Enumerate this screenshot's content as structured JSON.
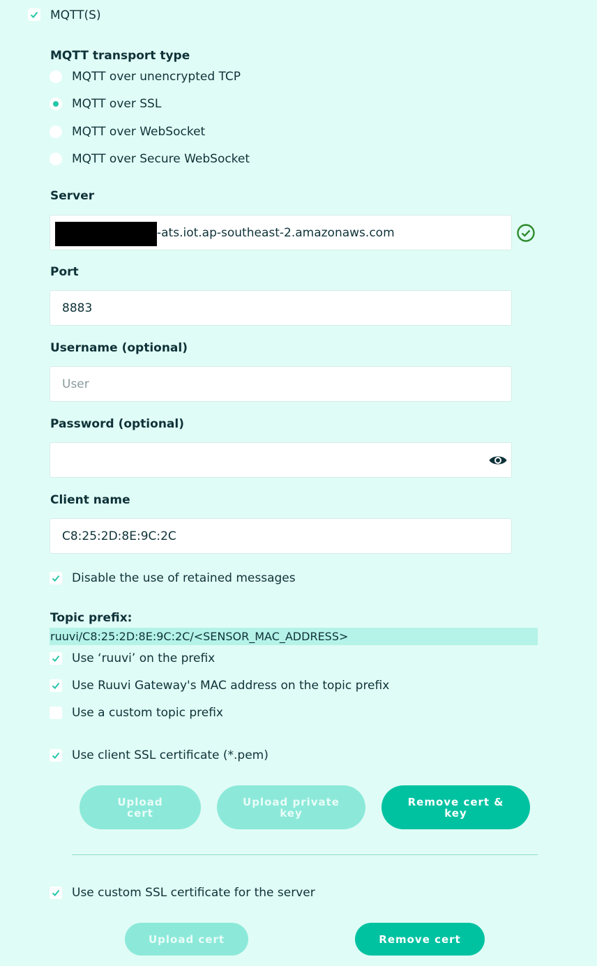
{
  "mqtt_toggle": {
    "label": "MQTT(S)",
    "checked": true
  },
  "transport": {
    "title": "MQTT transport type",
    "options": [
      {
        "label": "MQTT over unencrypted TCP",
        "selected": false
      },
      {
        "label": "MQTT over SSL",
        "selected": true
      },
      {
        "label": "MQTT over WebSocket",
        "selected": false
      },
      {
        "label": "MQTT over Secure WebSocket",
        "selected": false
      }
    ]
  },
  "server": {
    "label": "Server",
    "value_suffix": "-ats.iot.ap-southeast-2.amazonaws.com",
    "status_icon": "check-circle-icon"
  },
  "port": {
    "label": "Port",
    "value": "8883"
  },
  "username": {
    "label": "Username (optional)",
    "value": "",
    "placeholder": "User"
  },
  "password": {
    "label": "Password (optional)",
    "value": "",
    "icon": "eye-icon"
  },
  "client_name": {
    "label": "Client name",
    "value": "C8:25:2D:8E:9C:2C"
  },
  "disable_retained": {
    "label": "Disable the use of retained messages",
    "checked": true
  },
  "topic": {
    "label": "Topic prefix:",
    "value": "ruuvi/C8:25:2D:8E:9C:2C/<SENSOR_MAC_ADDRESS>",
    "options": [
      {
        "label": "Use ‘ruuvi’ on the prefix",
        "checked": true
      },
      {
        "label": "Use Ruuvi Gateway's MAC address on the topic prefix",
        "checked": true
      },
      {
        "label": "Use a custom topic prefix",
        "checked": false
      }
    ]
  },
  "client_cert": {
    "label": "Use client SSL certificate (*.pem)",
    "checked": true,
    "buttons": {
      "upload_cert": "Upload cert",
      "upload_key": "Upload private key",
      "remove": "Remove cert & key"
    }
  },
  "server_cert": {
    "label": "Use custom SSL certificate for the server",
    "checked": true,
    "buttons": {
      "upload_cert": "Upload cert",
      "remove": "Remove cert"
    }
  },
  "colors": {
    "accent": "#00c2a1",
    "background": "#e0fcf6",
    "text": "#0e3238",
    "valid": "#2e8b2e"
  }
}
